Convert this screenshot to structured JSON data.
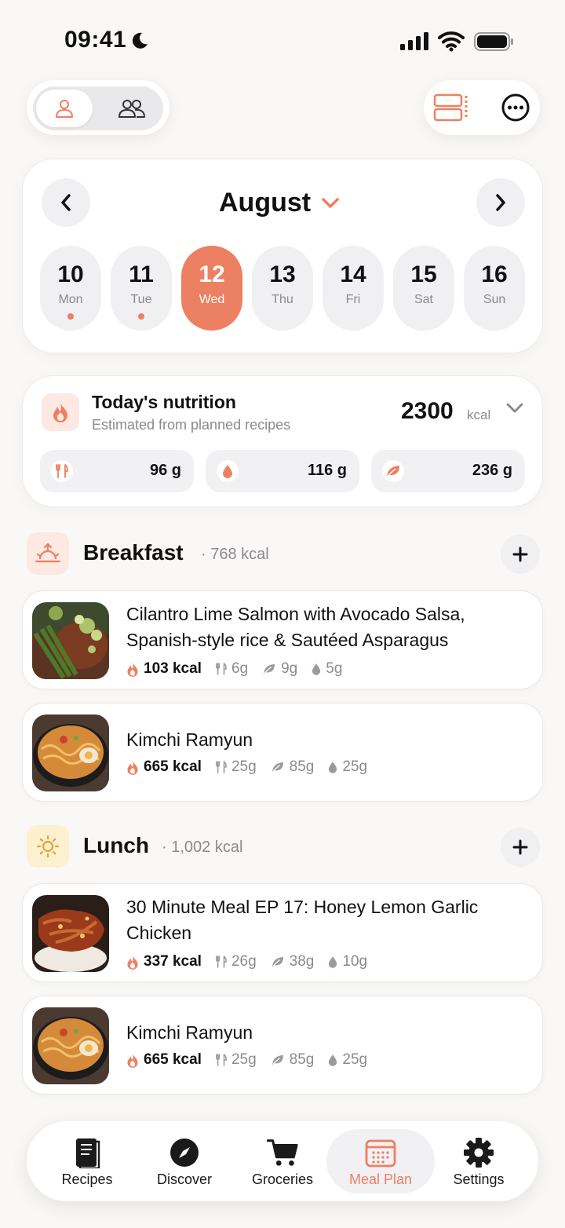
{
  "status_bar": {
    "time": "09:41"
  },
  "calendar": {
    "month": "August",
    "days": [
      {
        "num": "10",
        "name": "Mon",
        "has_meals": true
      },
      {
        "num": "11",
        "name": "Tue",
        "has_meals": true
      },
      {
        "num": "12",
        "name": "Wed",
        "selected": true
      },
      {
        "num": "13",
        "name": "Thu"
      },
      {
        "num": "14",
        "name": "Fri"
      },
      {
        "num": "15",
        "name": "Sat"
      },
      {
        "num": "16",
        "name": "Sun"
      }
    ]
  },
  "nutrition": {
    "title": "Today's nutrition",
    "subtitle": "Estimated from planned recipes",
    "kcal": "2300",
    "kcal_unit": "kcal",
    "macros": [
      {
        "icon": "fork-knife-icon",
        "value": "96 g"
      },
      {
        "icon": "drop-icon",
        "value": "116 g"
      },
      {
        "icon": "leaf-icon",
        "value": "236 g"
      }
    ]
  },
  "sections": [
    {
      "title": "Breakfast",
      "kcal": "· 768 kcal",
      "icon": "sunrise-icon",
      "meals": [
        {
          "name": "Cilantro Lime Salmon with Avocado Salsa, Spanish-style rice & Sautéed Asparagus",
          "kcal": "103 kcal",
          "protein": "6g",
          "carbs": "9g",
          "fat": "5g"
        },
        {
          "name": "Kimchi Ramyun",
          "kcal": "665 kcal",
          "protein": "25g",
          "carbs": "85g",
          "fat": "25g"
        }
      ]
    },
    {
      "title": "Lunch",
      "kcal": "· 1,002 kcal",
      "icon": "sun-icon",
      "meals": [
        {
          "name": "30 Minute Meal EP 17: Honey Lemon Garlic Chicken",
          "kcal": "337 kcal",
          "protein": "26g",
          "carbs": "38g",
          "fat": "10g"
        },
        {
          "name": "Kimchi Ramyun",
          "kcal": "665 kcal",
          "protein": "25g",
          "carbs": "85g",
          "fat": "25g"
        }
      ]
    }
  ],
  "tabs": [
    {
      "label": "Recipes",
      "icon": "book-icon"
    },
    {
      "label": "Discover",
      "icon": "compass-icon"
    },
    {
      "label": "Groceries",
      "icon": "cart-icon"
    },
    {
      "label": "Meal Plan",
      "icon": "calendar-icon",
      "active": true
    },
    {
      "label": "Settings",
      "icon": "gear-icon"
    }
  ],
  "colors": {
    "accent": "#ec8062",
    "background": "#faf8f6",
    "muted_text": "#8a8a90"
  }
}
